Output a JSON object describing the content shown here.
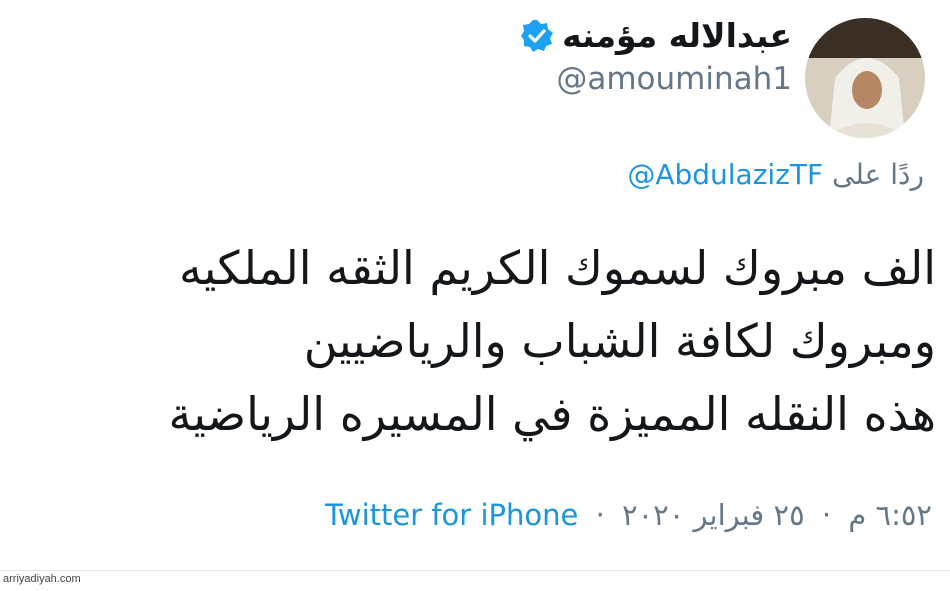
{
  "author": {
    "display_name": "عبدالاله مؤمنه",
    "handle": "@amouminah1",
    "verified": true
  },
  "reply": {
    "prefix": "ردًا على",
    "mention": "@AbdulazizTF"
  },
  "tweet": {
    "lines": [
      "الف مبروك لسموك الكريم الثقه الملكيه",
      "ومبروك لكافة الشباب والرياضيين",
      "هذه النقله المميزة في المسيره الرياضية"
    ]
  },
  "meta": {
    "time": "٦:٥٢ م",
    "separator": "·",
    "date": "٢٥ فبراير ٢٠٢٠",
    "source": "Twitter for iPhone"
  },
  "watermark": "arriyadiyah.com",
  "colors": {
    "link": "#1b95e0",
    "muted": "#657786",
    "text": "#14171a",
    "verified": "#1da1f2"
  }
}
